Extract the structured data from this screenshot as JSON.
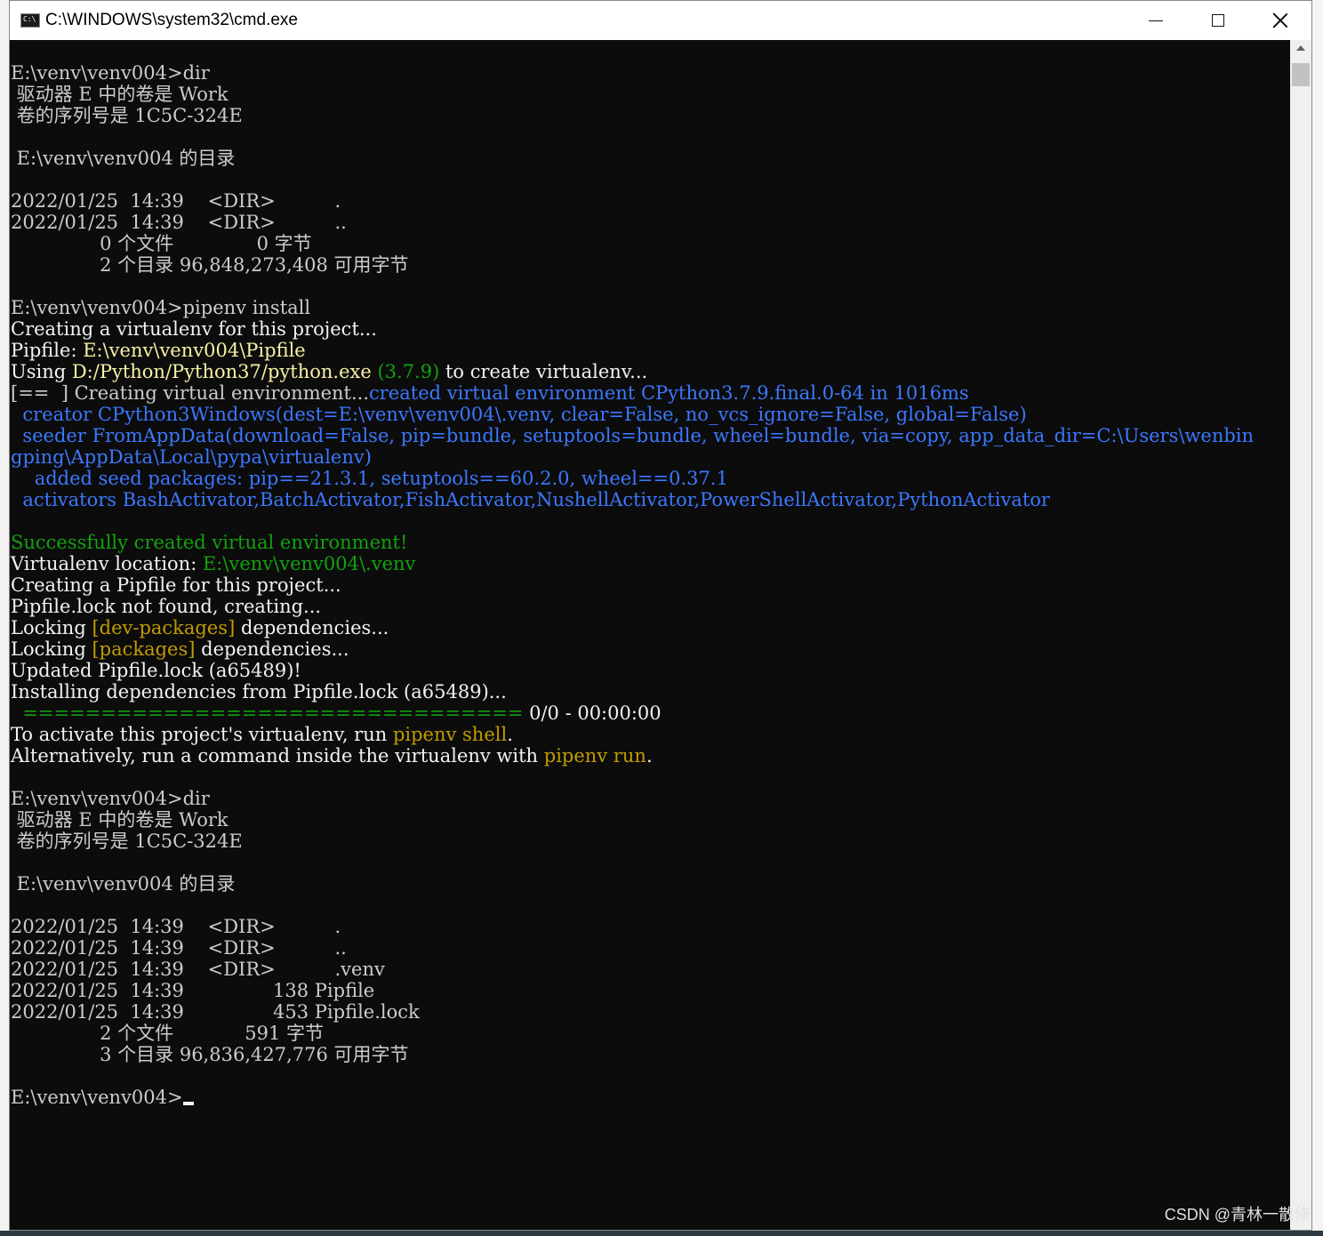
{
  "window": {
    "title": "C:\\WINDOWS\\system32\\cmd.exe",
    "icon": "cmd-icon",
    "controls": {
      "minimize_icon": "minimize-icon",
      "maximize_icon": "maximize-icon",
      "close_icon": "close-icon"
    }
  },
  "colors": {
    "background": "#0c0c0c",
    "text": "#cccccc",
    "yellow": "#f9f1a5",
    "dark_yellow": "#c19c00",
    "green": "#13a10e",
    "blue": "#3b78ff"
  },
  "console": {
    "lines": [
      [
        {
          "t": "E:\\venv\\venv004>dir",
          "c": "default"
        }
      ],
      [
        {
          "t": " 驱动器 E 中的卷是 Work",
          "c": "default"
        }
      ],
      [
        {
          "t": " 卷的序列号是 1C5C-324E",
          "c": "default"
        }
      ],
      [
        {
          "t": "",
          "c": "default"
        }
      ],
      [
        {
          "t": " E:\\venv\\venv004 的目录",
          "c": "default"
        }
      ],
      [
        {
          "t": "",
          "c": "default"
        }
      ],
      [
        {
          "t": "2022/01/25  14:39    <DIR>          .",
          "c": "default"
        }
      ],
      [
        {
          "t": "2022/01/25  14:39    <DIR>          ..",
          "c": "default"
        }
      ],
      [
        {
          "t": "               0 个文件              0 字节",
          "c": "default"
        }
      ],
      [
        {
          "t": "               2 个目录 96,848,273,408 可用字节",
          "c": "default"
        }
      ],
      [
        {
          "t": "",
          "c": "default"
        }
      ],
      [
        {
          "t": "E:\\venv\\venv004>pipenv install",
          "c": "default"
        }
      ],
      [
        {
          "t": "Creating a virtualenv for this project...",
          "c": "white"
        }
      ],
      [
        {
          "t": "Pipfile: ",
          "c": "white"
        },
        {
          "t": "E:\\venv\\venv004\\Pipfile",
          "c": "yellow"
        }
      ],
      [
        {
          "t": "Using ",
          "c": "white"
        },
        {
          "t": "D:/Python/Python37/python.exe",
          "c": "yellow"
        },
        {
          "t": " ",
          "c": "white"
        },
        {
          "t": "(3.7.9)",
          "c": "green"
        },
        {
          "t": " to create virtualenv...",
          "c": "white"
        }
      ],
      [
        {
          "t": "[==  ] Creating virtual environment...",
          "c": "default"
        },
        {
          "t": "created virtual environment CPython3.7.9.final.0-64 in 1016ms",
          "c": "blue"
        }
      ],
      [
        {
          "t": "  creator CPython3Windows(dest=E:\\venv\\venv004\\.venv, clear=False, no_vcs_ignore=False, global=False)",
          "c": "blue"
        }
      ],
      [
        {
          "t": "  seeder FromAppData(download=False, pip=bundle, setuptools=bundle, wheel=bundle, via=copy, app_data_dir=C:\\Users\\wenbin",
          "c": "blue"
        }
      ],
      [
        {
          "t": "gping\\AppData\\Local\\pypa\\virtualenv)",
          "c": "blue"
        }
      ],
      [
        {
          "t": "    added seed packages: pip==21.3.1, setuptools==60.2.0, wheel==0.37.1",
          "c": "blue"
        }
      ],
      [
        {
          "t": "  activators BashActivator,BatchActivator,FishActivator,NushellActivator,PowerShellActivator,PythonActivator",
          "c": "blue"
        }
      ],
      [
        {
          "t": "",
          "c": "default"
        }
      ],
      [
        {
          "t": "Successfully created virtual environment!",
          "c": "green"
        }
      ],
      [
        {
          "t": "Virtualenv location: ",
          "c": "white"
        },
        {
          "t": "E:\\venv\\venv004\\.venv",
          "c": "green"
        }
      ],
      [
        {
          "t": "Creating a Pipfile for this project...",
          "c": "white"
        }
      ],
      [
        {
          "t": "Pipfile.lock not found, creating...",
          "c": "white"
        }
      ],
      [
        {
          "t": "Locking ",
          "c": "white"
        },
        {
          "t": "[dev-packages]",
          "c": "dyellow"
        },
        {
          "t": " dependencies...",
          "c": "white"
        }
      ],
      [
        {
          "t": "Locking ",
          "c": "white"
        },
        {
          "t": "[packages]",
          "c": "dyellow"
        },
        {
          "t": " dependencies...",
          "c": "white"
        }
      ],
      [
        {
          "t": "Updated Pipfile.lock (a65489)!",
          "c": "white"
        }
      ],
      [
        {
          "t": "Installing dependencies from Pipfile.lock (a65489)...",
          "c": "white"
        }
      ],
      [
        {
          "t": "  ================================",
          "c": "green"
        },
        {
          "t": " 0/0 - 00:00:00",
          "c": "white"
        }
      ],
      [
        {
          "t": "To activate this project's virtualenv, run ",
          "c": "white"
        },
        {
          "t": "pipenv shell",
          "c": "dyellow"
        },
        {
          "t": ".",
          "c": "white"
        }
      ],
      [
        {
          "t": "Alternatively, run a command inside the virtualenv with ",
          "c": "white"
        },
        {
          "t": "pipenv run",
          "c": "dyellow"
        },
        {
          "t": ".",
          "c": "white"
        }
      ],
      [
        {
          "t": "",
          "c": "default"
        }
      ],
      [
        {
          "t": "E:\\venv\\venv004>dir",
          "c": "default"
        }
      ],
      [
        {
          "t": " 驱动器 E 中的卷是 Work",
          "c": "default"
        }
      ],
      [
        {
          "t": " 卷的序列号是 1C5C-324E",
          "c": "default"
        }
      ],
      [
        {
          "t": "",
          "c": "default"
        }
      ],
      [
        {
          "t": " E:\\venv\\venv004 的目录",
          "c": "default"
        }
      ],
      [
        {
          "t": "",
          "c": "default"
        }
      ],
      [
        {
          "t": "2022/01/25  14:39    <DIR>          .",
          "c": "default"
        }
      ],
      [
        {
          "t": "2022/01/25  14:39    <DIR>          ..",
          "c": "default"
        }
      ],
      [
        {
          "t": "2022/01/25  14:39    <DIR>          .venv",
          "c": "default"
        }
      ],
      [
        {
          "t": "2022/01/25  14:39               138 Pipfile",
          "c": "default"
        }
      ],
      [
        {
          "t": "2022/01/25  14:39               453 Pipfile.lock",
          "c": "default"
        }
      ],
      [
        {
          "t": "               2 个文件            591 字节",
          "c": "default"
        }
      ],
      [
        {
          "t": "               3 个目录 96,836,427,776 可用字节",
          "c": "default"
        }
      ],
      [
        {
          "t": "",
          "c": "default"
        }
      ],
      [
        {
          "t": "E:\\venv\\venv004>",
          "c": "default"
        }
      ]
    ],
    "cursor_line": 48
  },
  "watermark": "CSDN @青林一散修"
}
